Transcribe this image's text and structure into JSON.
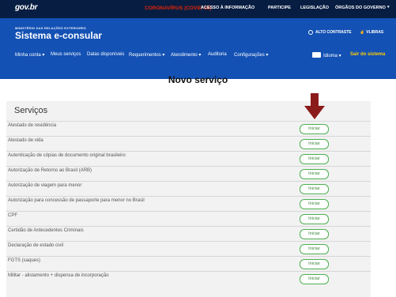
{
  "govbar": {
    "logo": "gov.br",
    "covid": "CORONAVÍRUS (COVID-19)",
    "links": [
      "ACESSO À INFORMAÇÃO",
      "PARTICIPE",
      "LEGISLAÇÃO",
      "ÓRGÃOS DO GOVERNO"
    ]
  },
  "header": {
    "ministry": "MINISTÉRIO DAS RELAÇÕES EXTERIORES",
    "system_name": "Sistema e-consular",
    "alto_contraste": "ALTO CONTRASTE",
    "vlibras": "VLIBRAS"
  },
  "nav": {
    "items": [
      "Minha conta ▾",
      "Meus serviços",
      "Datas disponíveis",
      "Requerimentos ▾",
      "Atendimento ▾",
      "Auditoria",
      "Configurações ▾"
    ],
    "idioma": "Idioma ▾",
    "sair": "Sair do sistema"
  },
  "page_title": "Novo serviço",
  "services": {
    "title": "Serviços",
    "button_label": "Iniciar",
    "items": [
      "Atestado de residência",
      "Atestado de vida",
      "Autenticação de cópias de documento original brasileiro",
      "Autorização de Retorno ao Brasil (ARB)",
      "Autorização de viagem para menor",
      "Autorização para concessão de passaporte para menor no Brasil",
      "CPF",
      "Certidão de Antecedentes Criminais",
      "Declaração de estado civil",
      "FGTS (saques)",
      "Militar - alistamento + dispensa de incorporação"
    ]
  },
  "colors": {
    "govbar": "#071d41",
    "header": "#1351b4",
    "covid": "#e52207",
    "sair": "#ffcd07",
    "button_border": "#4caf50",
    "arrow": "#8b1a1a"
  }
}
